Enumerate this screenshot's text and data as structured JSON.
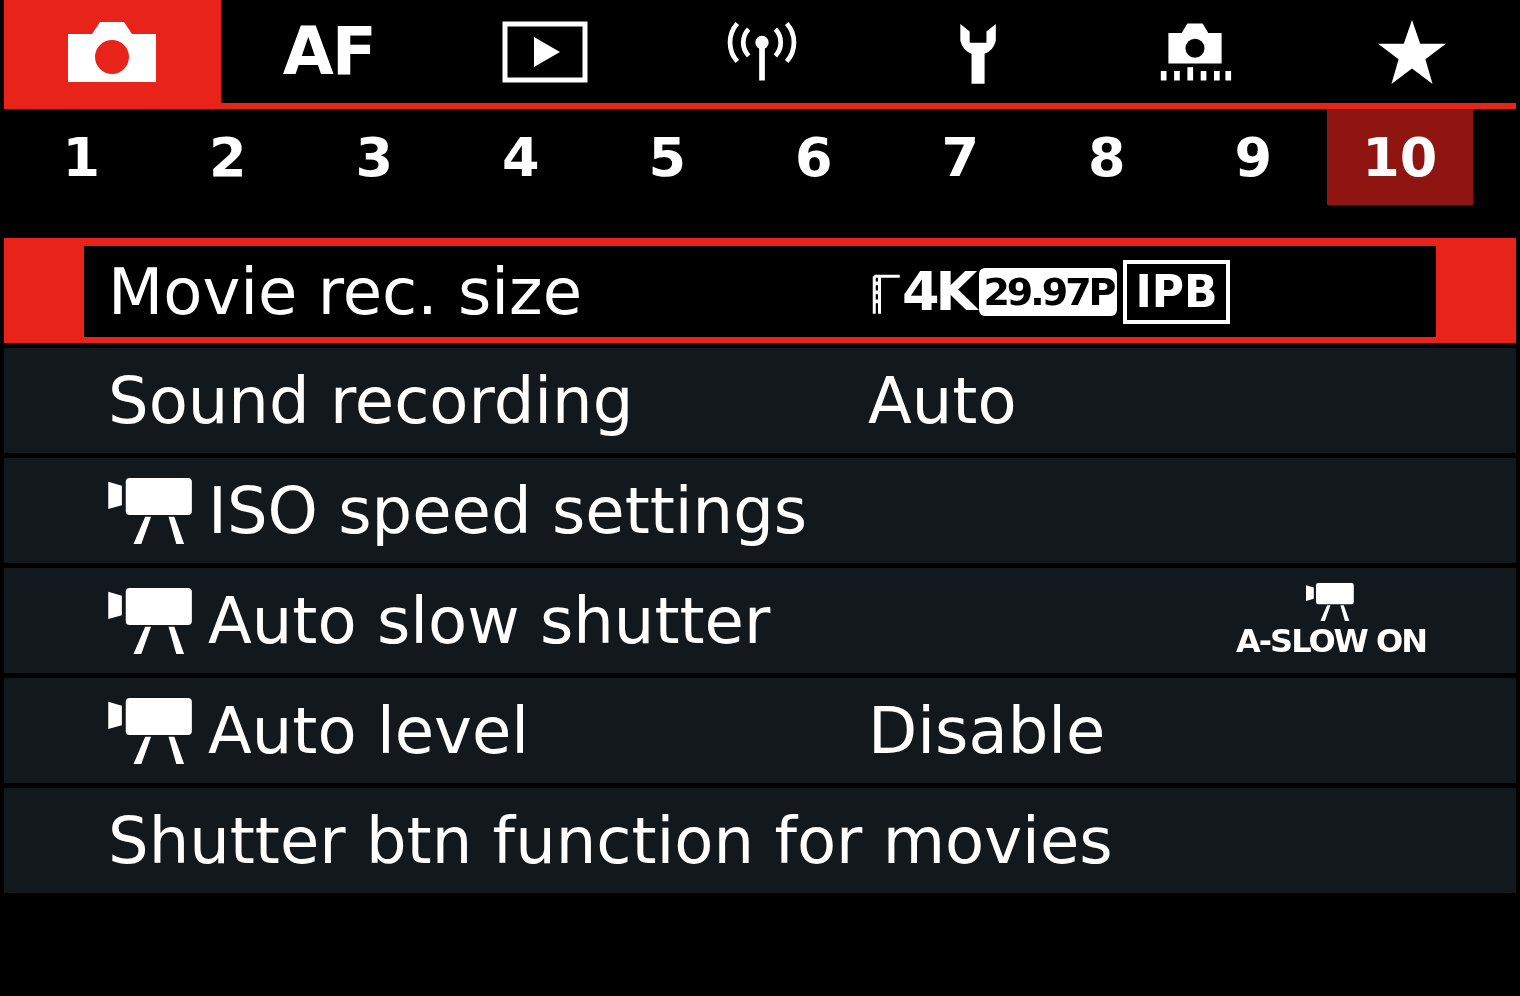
{
  "tabs": [
    {
      "kind": "camera",
      "selected": true
    },
    {
      "kind": "text",
      "label": "AF",
      "selected": false
    },
    {
      "kind": "play",
      "selected": false
    },
    {
      "kind": "wireless",
      "selected": false
    },
    {
      "kind": "wrench",
      "selected": false
    },
    {
      "kind": "custom",
      "selected": false
    },
    {
      "kind": "star",
      "selected": false
    }
  ],
  "pages": [
    {
      "label": "1",
      "selected": false
    },
    {
      "label": "2",
      "selected": false
    },
    {
      "label": "3",
      "selected": false
    },
    {
      "label": "4",
      "selected": false
    },
    {
      "label": "5",
      "selected": false
    },
    {
      "label": "6",
      "selected": false
    },
    {
      "label": "7",
      "selected": false
    },
    {
      "label": "8",
      "selected": false
    },
    {
      "label": "9",
      "selected": false
    },
    {
      "label": "10",
      "selected": true
    }
  ],
  "items": [
    {
      "label": "Movie rec. size",
      "movie_icon": false,
      "selected": true,
      "kind": "badges",
      "badges": [
        "4K",
        "29.97P",
        "IPB"
      ]
    },
    {
      "label": "Sound recording",
      "movie_icon": false,
      "selected": false,
      "kind": "text",
      "value": "Auto"
    },
    {
      "label": "ISO speed settings",
      "movie_icon": true,
      "selected": false
    },
    {
      "label": "Auto slow shutter",
      "movie_icon": true,
      "selected": false,
      "kind": "aslow",
      "value": "A-SLOW ON"
    },
    {
      "label": "Auto level",
      "movie_icon": true,
      "selected": false,
      "kind": "text",
      "value": "Disable"
    },
    {
      "label": "Shutter btn function for movies",
      "movie_icon": false,
      "selected": false
    }
  ]
}
